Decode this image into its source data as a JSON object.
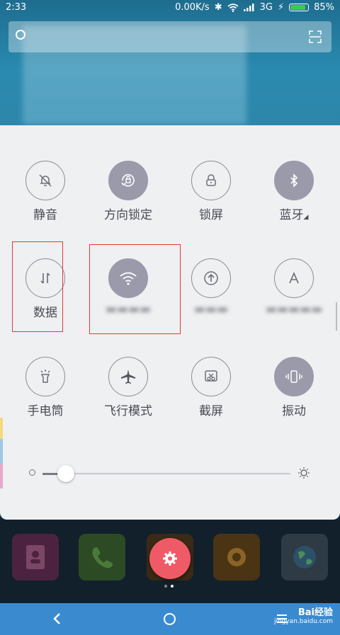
{
  "statusbar": {
    "time": "2:33",
    "net_speed": "0.00K/s",
    "network": "3G",
    "battery": "85%"
  },
  "tiles": [
    {
      "label": "静音",
      "icon": "bell-off-icon",
      "active": false
    },
    {
      "label": "方向锁定",
      "icon": "rotation-lock-icon",
      "active": true
    },
    {
      "label": "锁屏",
      "icon": "lock-icon",
      "active": false
    },
    {
      "label": "蓝牙",
      "icon": "bluetooth-icon",
      "active": true
    },
    {
      "label": "数据",
      "icon": "data-arrows-icon",
      "active": false
    },
    {
      "label": "",
      "icon": "wifi-icon",
      "active": true
    },
    {
      "label": "",
      "icon": "upload-icon",
      "active": false
    },
    {
      "label": "",
      "icon": "auto-brightness-icon",
      "active": false
    },
    {
      "label": "手电筒",
      "icon": "flashlight-icon",
      "active": false
    },
    {
      "label": "飞行模式",
      "icon": "airplane-icon",
      "active": false
    },
    {
      "label": "截屏",
      "icon": "screenshot-icon",
      "active": false
    },
    {
      "label": "振动",
      "icon": "vibrate-icon",
      "active": true
    }
  ],
  "brightness": {
    "value": 0.09
  },
  "watermark": {
    "brand": "Bai经验",
    "url": "jingyan.baidu.com"
  },
  "colors": {
    "accent": "#9b9aab",
    "fab": "#ee5b66",
    "navbar": "#3a8ad0",
    "highlight": "#e53935"
  }
}
